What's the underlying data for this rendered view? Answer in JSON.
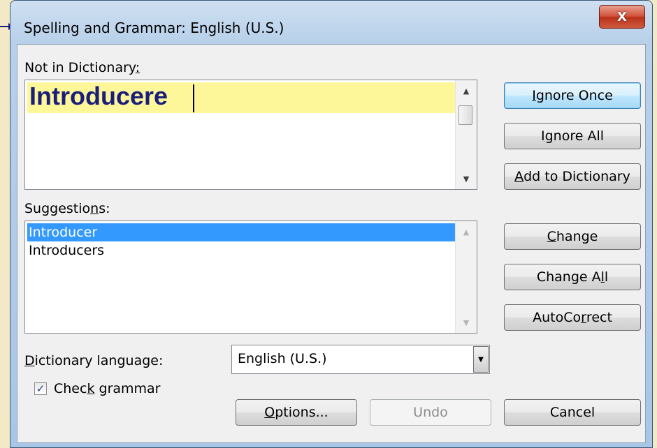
{
  "window": {
    "title": "Spelling and Grammar: English (U.S.)",
    "close_glyph": "X"
  },
  "not_in_dictionary": {
    "label_pre": "Not in Dictionary",
    "label_accel": ":",
    "word": "Introducere"
  },
  "suggestions": {
    "label_pre": "Suggestio",
    "label_accel": "n",
    "label_post": "s:",
    "items": [
      "Introducer",
      "Introducers"
    ],
    "selected_index": 0
  },
  "buttons": {
    "ignore_once": {
      "accel": "I",
      "rest": "gnore Once"
    },
    "ignore_all": {
      "pre": "I",
      "accel": "g",
      "rest": "nore All"
    },
    "add_to_dictionary": {
      "accel": "A",
      "rest": "dd to Dictionary"
    },
    "change": {
      "accel": "C",
      "rest": "hange"
    },
    "change_all": {
      "pre": "Change A",
      "accel": "l",
      "rest": "l"
    },
    "autocorrect": {
      "pre": "AutoCo",
      "accel": "r",
      "rest": "rect"
    },
    "options": {
      "accel": "O",
      "rest": "ptions..."
    },
    "undo": "Undo",
    "cancel": "Cancel"
  },
  "dictionary_language": {
    "label_accel": "D",
    "label_rest": "ictionary language:",
    "value": "English (U.S.)"
  },
  "check_grammar": {
    "label_pre": "Chec",
    "label_accel": "k",
    "label_post": " grammar",
    "checked": true,
    "check_glyph": "✓"
  },
  "colors": {
    "selection": "#3399ff",
    "highlight": "#fdf79a",
    "word": "#1a1e7a"
  }
}
